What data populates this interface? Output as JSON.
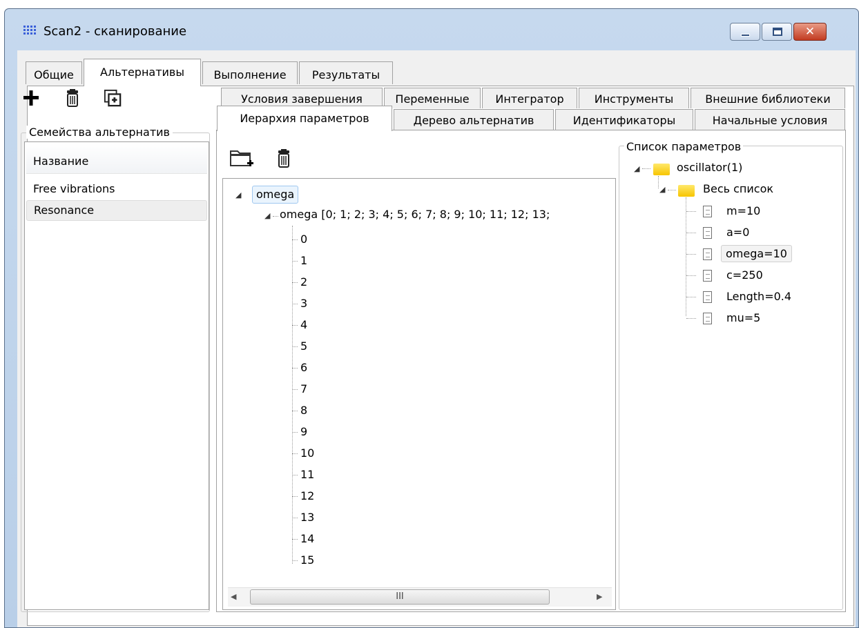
{
  "window": {
    "title": "Scan2 - сканирование"
  },
  "main_tabs": [
    {
      "label": "Общие"
    },
    {
      "label": "Альтернативы"
    },
    {
      "label": "Выполнение"
    },
    {
      "label": "Результаты"
    }
  ],
  "toolbar": {
    "add_icon": "plus-icon",
    "delete_icon": "trash-icon",
    "copy_icon": "copy-add-icon"
  },
  "families": {
    "title": "Семейства альтернатив",
    "header": "Название",
    "items": [
      {
        "label": "Free vibrations"
      },
      {
        "label": "Resonance"
      }
    ]
  },
  "inner_tabs_row1": [
    {
      "label": "Условия завершения"
    },
    {
      "label": "Переменные"
    },
    {
      "label": "Интегратор"
    },
    {
      "label": "Инструменты"
    },
    {
      "label": "Внешние библиотеки"
    }
  ],
  "inner_tabs_row2": [
    {
      "label": "Иерархия параметров"
    },
    {
      "label": "Дерево альтернатив"
    },
    {
      "label": "Идентификаторы"
    },
    {
      "label": "Начальные условия"
    }
  ],
  "hierarchy": {
    "root": "omega",
    "child": "omega [0; 1; 2; 3; 4; 5; 6; 7; 8; 9; 10; 11; 12; 13;",
    "leaves": [
      "0",
      "1",
      "2",
      "3",
      "4",
      "5",
      "6",
      "7",
      "8",
      "9",
      "10",
      "11",
      "12",
      "13",
      "14",
      "15"
    ],
    "scroll_thumb_glyph": "III"
  },
  "params": {
    "title": "Список параметров",
    "root": "oscillator(1)",
    "group": "Весь список",
    "items": [
      {
        "label": "m=10"
      },
      {
        "label": "a=0"
      },
      {
        "label": "omega=10"
      },
      {
        "label": "c=250"
      },
      {
        "label": "Length=0.4"
      },
      {
        "label": "mu=5"
      }
    ]
  }
}
